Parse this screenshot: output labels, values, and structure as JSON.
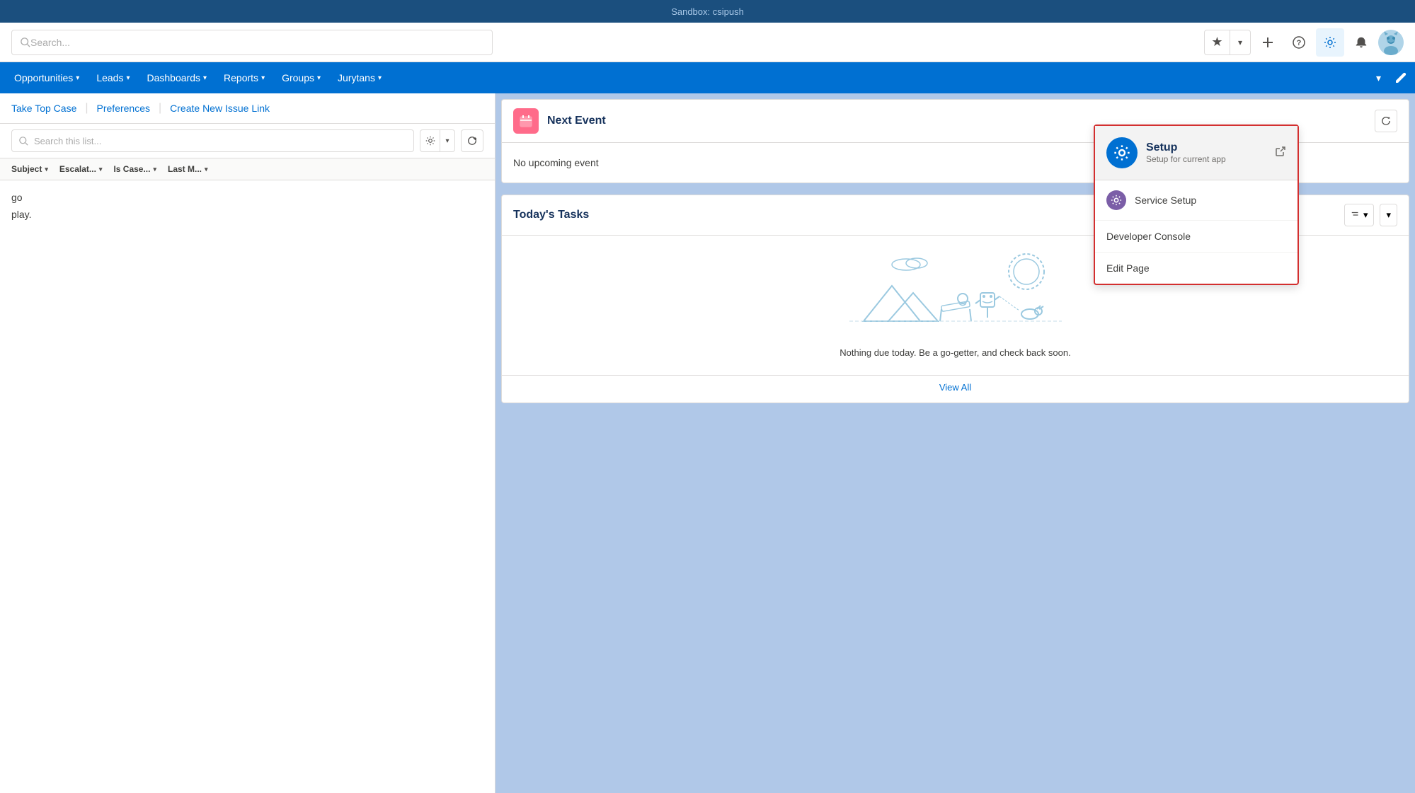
{
  "topBanner": {
    "text": "Sandbox: csipush"
  },
  "header": {
    "searchPlaceholder": "Search...",
    "icons": {
      "star": "★",
      "plus": "+",
      "help": "?",
      "gear": "⚙",
      "bell": "🔔"
    }
  },
  "nav": {
    "items": [
      {
        "label": "Opportunities",
        "hasDropdown": true
      },
      {
        "label": "Leads",
        "hasDropdown": true
      },
      {
        "label": "Dashboards",
        "hasDropdown": true
      },
      {
        "label": "Reports",
        "hasDropdown": true
      },
      {
        "label": "Groups",
        "hasDropdown": true
      },
      {
        "label": "Jurytans",
        "hasDropdown": true
      }
    ],
    "editIcon": "✏"
  },
  "leftPanel": {
    "buttons": {
      "takeTopCase": "Take Top Case",
      "preferences": "Preferences",
      "createNewIssueLink": "Create New Issue Link"
    },
    "searchPlaceholder": "Search this list...",
    "tableColumns": [
      {
        "label": "Subject"
      },
      {
        "label": "Escalat..."
      },
      {
        "label": "Is Case..."
      },
      {
        "label": "Last M..."
      }
    ],
    "partialTexts": {
      "go": "go",
      "play": "play."
    }
  },
  "rightPanel": {
    "nextEvent": {
      "title": "Next Event",
      "noEventText": "No upcoming event"
    },
    "todaysTasks": {
      "title": "Today's Tasks",
      "emptyText": "Nothing due today. Be a go-getter, and check back soon.",
      "viewAllLabel": "View All"
    }
  },
  "dropdown": {
    "setup": {
      "title": "Setup",
      "subtitle": "Setup for current app",
      "externalIcon": "⬡"
    },
    "serviceSetup": {
      "label": "Service Setup"
    },
    "developerConsole": {
      "label": "Developer Console"
    },
    "editPage": {
      "label": "Edit Page"
    }
  },
  "colors": {
    "primary": "#0070d2",
    "navBg": "#0070d2",
    "bannerBg": "#1b4f7e",
    "dropdownBorder": "#d32f2f",
    "calendarIconBg": "#ff6b8a",
    "setupIconBg": "#0070d2",
    "serviceIconBg": "#7b5ea7"
  }
}
